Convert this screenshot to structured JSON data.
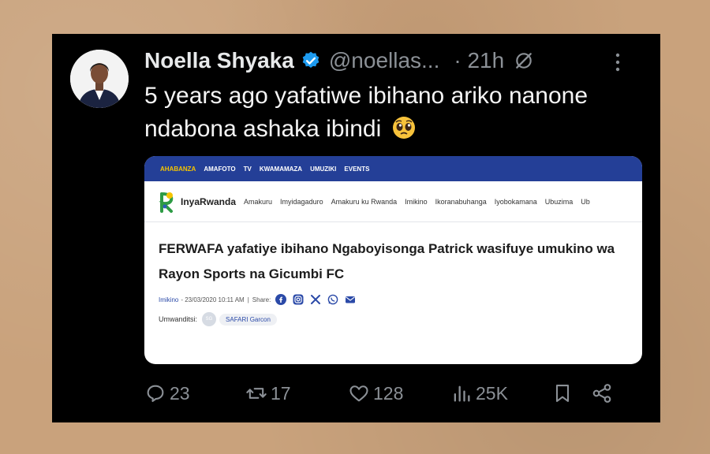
{
  "user": {
    "name": "Noella Shyaka",
    "handle": "@noellas...",
    "time": "· 21h"
  },
  "tweet": {
    "text": "5 years ago yafatiwe ibihano ariko nanone ndabona ashaka ibindi"
  },
  "card": {
    "topnav": [
      "AHABANZA",
      "AMAFOTO",
      "TV",
      "KWAMAMAZA",
      "UMUZIKI",
      "EVENTS"
    ],
    "brand": "InyaRwanda",
    "menu": [
      "Amakuru",
      "Imyidagaduro",
      "Amakuru ku Rwanda",
      "Imikino",
      "Ikoranabuhanga",
      "Iyobokamana",
      "Ubuzima",
      "Ub"
    ],
    "headline": "FERWAFA yafatiye ibihano Ngaboyisonga Patrick wasifuye umukino wa Rayon Sports na Gicumbi FC",
    "category": "Imikino",
    "date": "- 23/03/2020 10:11 AM",
    "divider": "|",
    "share_label": "Share:",
    "author_label": "Umwanditsi:",
    "author_initials": "SG",
    "author_name": "SAFARI Garcon"
  },
  "actions": {
    "replies": "23",
    "retweets": "17",
    "likes": "128",
    "views": "25K"
  },
  "colors": {
    "tweet_bg": "#000000",
    "nav_blue": "#243f97",
    "verified_blue": "#1d9bf0",
    "background_paper": "#c9a27c"
  }
}
